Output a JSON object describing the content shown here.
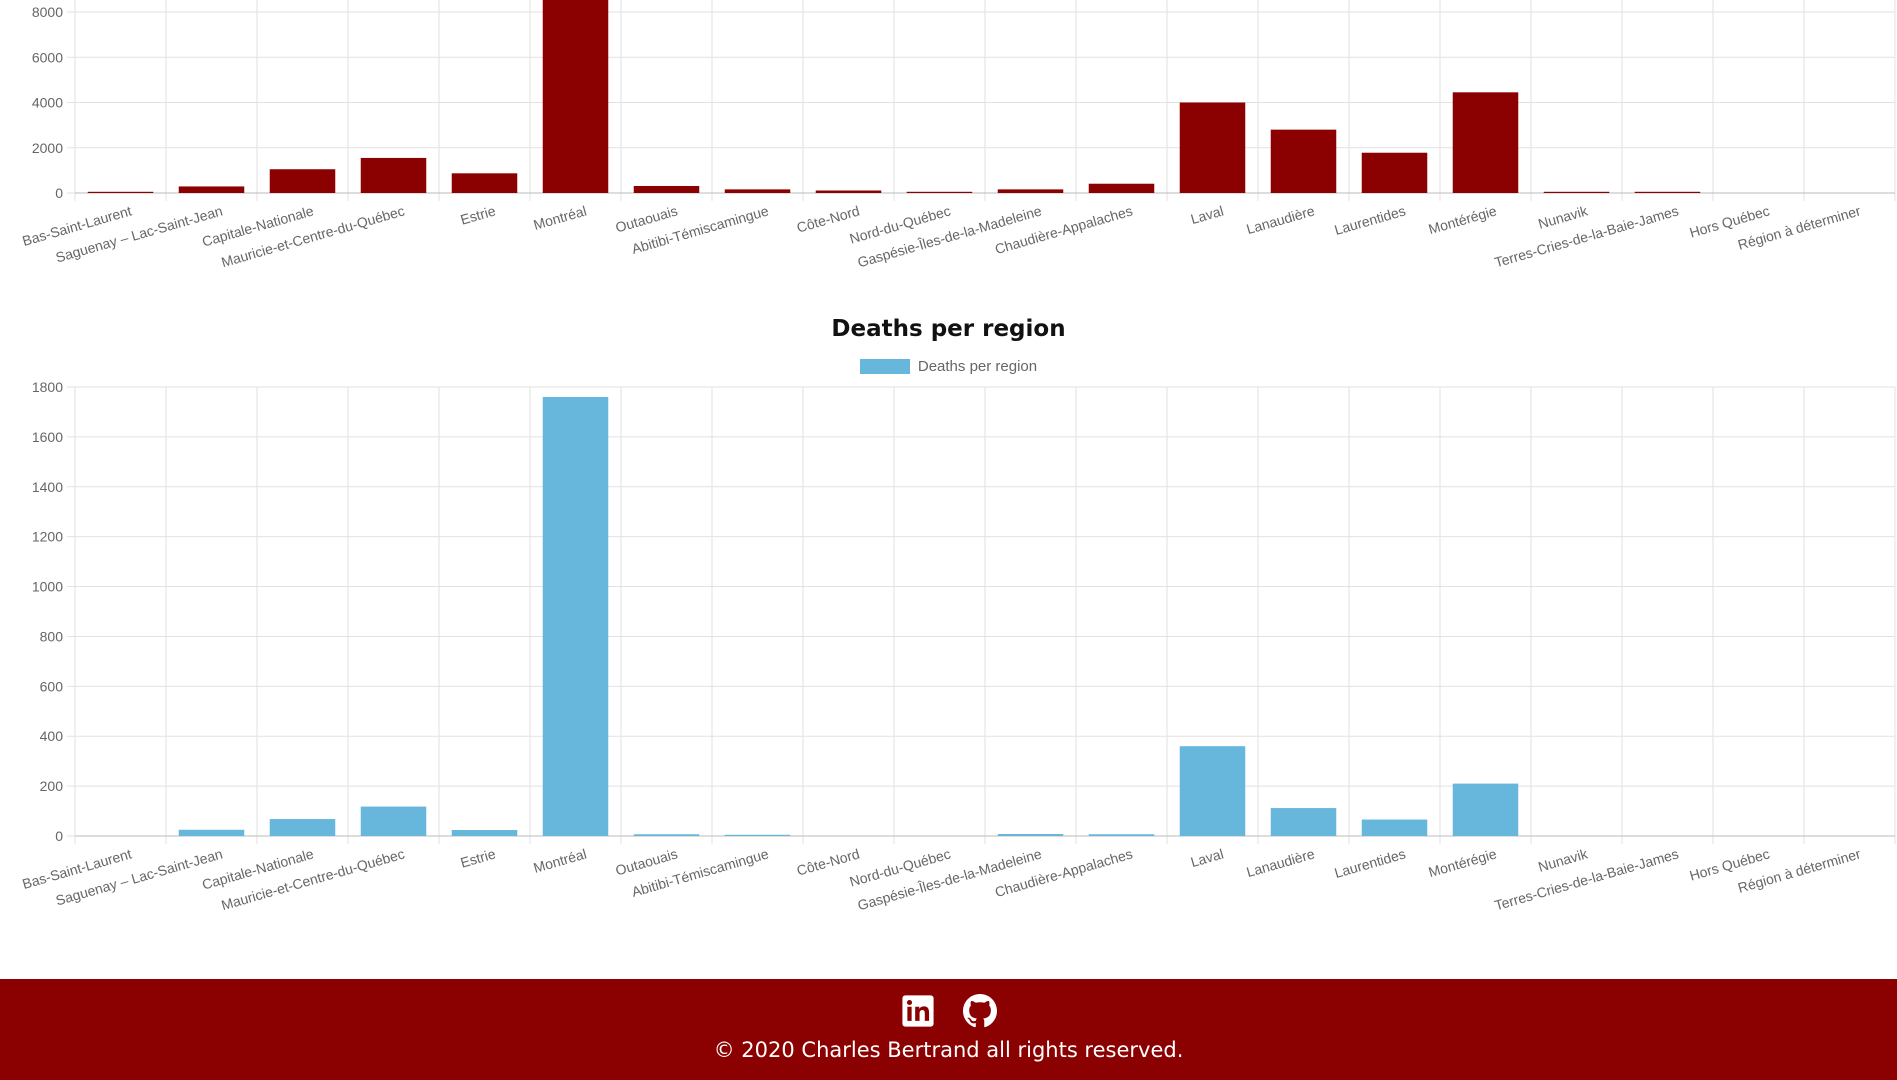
{
  "colors": {
    "cases_bar": "#8b0000",
    "deaths_bar": "#67b7dc",
    "footer_bg": "#8b0000",
    "grid": "#e2e2e2",
    "axis_text": "#666666"
  },
  "chart_data": [
    {
      "type": "bar",
      "title": "",
      "categories": [
        "Bas-Saint-Laurent",
        "Saguenay – Lac-Saint-Jean",
        "Capitale-Nationale",
        "Mauricie-et-Centre-du-Québec",
        "Estrie",
        "Montréal",
        "Outaouais",
        "Abitibi-Témiscamingue",
        "Côte-Nord",
        "Nord-du-Québec",
        "Gaspésie-Îles-de-la-Madeleine",
        "Chaudière-Appalaches",
        "Laval",
        "Lanaudière",
        "Laurentides",
        "Montérégie",
        "Nunavik",
        "Terres-Cries-de-la-Baie-James",
        "Hors Québec",
        "Région à déterminer"
      ],
      "values": [
        50,
        290,
        1050,
        1550,
        870,
        9400,
        310,
        160,
        110,
        25,
        160,
        410,
        4000,
        2800,
        1780,
        4450,
        20,
        20,
        0,
        0
      ],
      "ylim": [
        0,
        8000
      ],
      "yticks": [
        0,
        2000,
        4000,
        6000,
        8000
      ],
      "grid": true
    },
    {
      "type": "bar",
      "title": "Deaths per region",
      "series": [
        {
          "name": "Deaths per region"
        }
      ],
      "categories": [
        "Bas-Saint-Laurent",
        "Saguenay – Lac-Saint-Jean",
        "Capitale-Nationale",
        "Mauricie-et-Centre-du-Québec",
        "Estrie",
        "Montréal",
        "Outaouais",
        "Abitibi-Témiscamingue",
        "Côte-Nord",
        "Nord-du-Québec",
        "Gaspésie-Îles-de-la-Madeleine",
        "Chaudière-Appalaches",
        "Laval",
        "Lanaudière",
        "Laurentides",
        "Montérégie",
        "Nunavik",
        "Terres-Cries-de-la-Baie-James",
        "Hors Québec",
        "Région à déterminer"
      ],
      "values": [
        0,
        25,
        68,
        118,
        24,
        1760,
        7,
        2,
        0,
        0,
        8,
        7,
        360,
        112,
        66,
        210,
        0,
        0,
        0,
        0
      ],
      "ylim": [
        0,
        1800
      ],
      "yticks": [
        0,
        200,
        400,
        600,
        800,
        1000,
        1200,
        1400,
        1600,
        1800
      ],
      "legend": "top",
      "grid": true
    }
  ],
  "footer": {
    "icons": [
      "linkedin-icon",
      "github-icon"
    ],
    "copyright": "© 2020 Charles Bertrand all rights reserved."
  }
}
